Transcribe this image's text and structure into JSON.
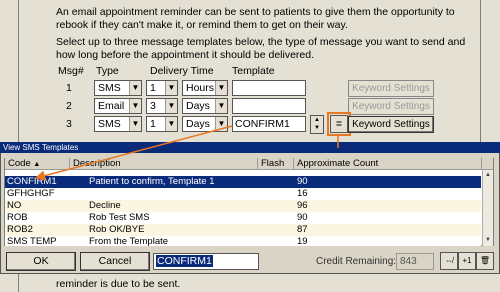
{
  "reminder": {
    "intro": "An email appointment reminder can be sent to patients to give them the opportunity to rebook if they can't make it, or remind them to get on their way.",
    "instructions": "Select up to three message templates below, the type of message you want to send and how long before the appointment it should be delivered.",
    "headers": {
      "msg": "Msg#",
      "type": "Type",
      "delivery": "Delivery Time",
      "template": "Template"
    },
    "rows": [
      {
        "num": "1",
        "type": "SMS",
        "amount": "1",
        "unit": "Hours",
        "template": "",
        "keyword": "Keyword Settings"
      },
      {
        "num": "2",
        "type": "Email",
        "amount": "3",
        "unit": "Days",
        "template": "",
        "keyword": "Keyword Settings"
      },
      {
        "num": "3",
        "type": "SMS",
        "amount": "1",
        "unit": "Days",
        "template": "CONFIRM1",
        "keyword": "Keyword Settings"
      }
    ],
    "footer": "reminder is due to be sent."
  },
  "dialog": {
    "title": "View SMS Templates",
    "columns": {
      "code": "Code",
      "description": "Description",
      "flash": "Flash",
      "count": "Approximate Count"
    },
    "rows": [
      {
        "code": "CONFIRM1",
        "description": "Patient to confirm, Template 1",
        "flash": "",
        "count": "90"
      },
      {
        "code": "GFHGHGF",
        "description": "",
        "flash": "",
        "count": "16"
      },
      {
        "code": "NO",
        "description": "Decline",
        "flash": "",
        "count": "96"
      },
      {
        "code": "ROB",
        "description": "Rob Test SMS",
        "flash": "",
        "count": "90"
      },
      {
        "code": "ROB2",
        "description": "Rob OK/BYE",
        "flash": "",
        "count": "87"
      },
      {
        "code": "SMS TEMP",
        "description": "From the Template",
        "flash": "",
        "count": "19"
      }
    ],
    "ok": "OK",
    "cancel": "Cancel",
    "selected": "CONFIRM1",
    "credit_label": "Credit Remaining:",
    "credit_value": "843",
    "btn_plus": "+1"
  }
}
